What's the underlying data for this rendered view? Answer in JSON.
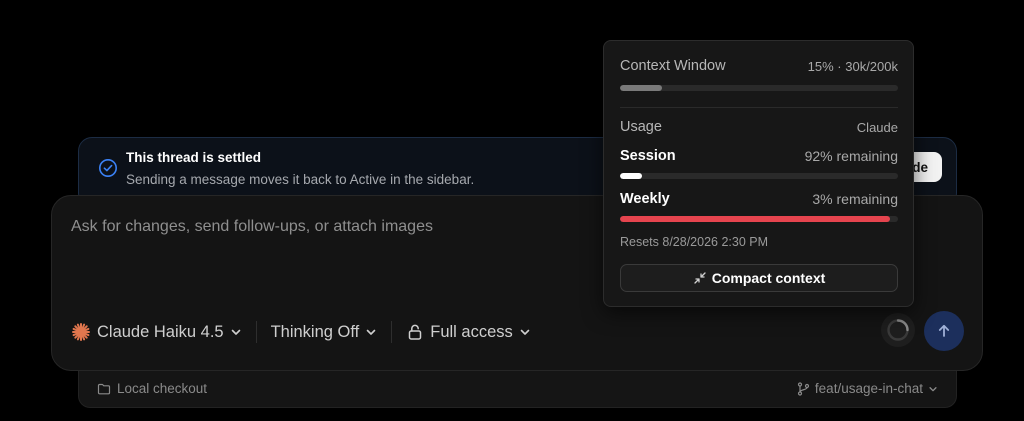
{
  "banner": {
    "title": "This thread is settled",
    "subtitle": "Sending a message moves it back to Active in the sidebar.",
    "action_label": "de"
  },
  "composer": {
    "placeholder": "Ask for changes, send follow-ups, or attach images",
    "model_label": "Claude Haiku 4.5",
    "thinking_label": "Thinking Off",
    "access_label": "Full access",
    "icons": {
      "model": "claude-sunburst-icon",
      "access": "lock-icon",
      "send": "arrow-up-icon",
      "status": "spinner-icon"
    }
  },
  "footer": {
    "checkout_label": "Local checkout",
    "branch_label": "feat/usage-in-chat"
  },
  "popover": {
    "context_title": "Context Window",
    "context_meta": "15% · 30k/200k",
    "context_fraction": 0.15,
    "usage_title": "Usage",
    "usage_provider": "Claude",
    "session_label": "Session",
    "session_meta": "92% remaining",
    "session_used_fraction": 0.08,
    "weekly_label": "Weekly",
    "weekly_meta": "3% remaining",
    "weekly_used_fraction": 0.97,
    "resets_text": "Resets 8/28/2026 2:30 PM",
    "compact_label": "Compact context"
  },
  "colors": {
    "accent_blue": "#3b82f6",
    "weekly_bar": "#e5444e",
    "session_bar": "#ffffff",
    "context_bar": "#7a7a7a",
    "claude_orange": "#e0764e"
  }
}
